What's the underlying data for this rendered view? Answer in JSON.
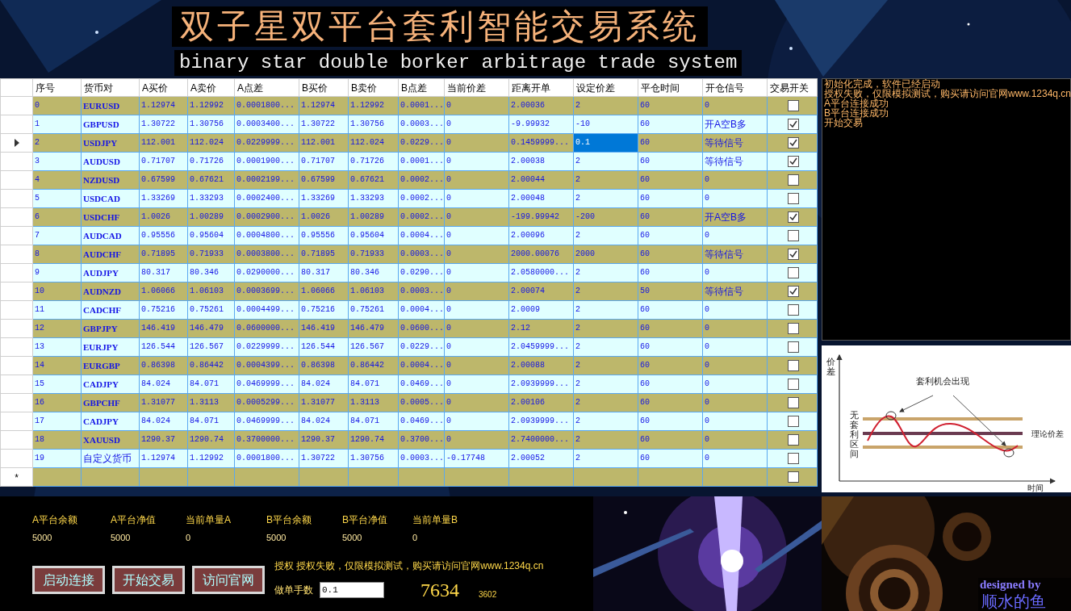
{
  "title": "双子星双平台套利智能交易系统",
  "subtitle": "binary star double borker arbitrage trade system",
  "table": {
    "columns": [
      {
        "label": "序号",
        "kind": "text"
      },
      {
        "label": "货币对",
        "kind": "pair"
      },
      {
        "label": "A买价",
        "kind": "text"
      },
      {
        "label": "A卖价",
        "kind": "text"
      },
      {
        "label": "A点差",
        "kind": "text"
      },
      {
        "label": "B买价",
        "kind": "text"
      },
      {
        "label": "B卖价",
        "kind": "text"
      },
      {
        "label": "B点差",
        "kind": "text"
      },
      {
        "label": "当前价差",
        "kind": "text"
      },
      {
        "label": "距离开单",
        "kind": "text"
      },
      {
        "label": "设定价差",
        "kind": "editable"
      },
      {
        "label": "平仓时间",
        "kind": "text"
      },
      {
        "label": "开仓信号",
        "kind": "text"
      },
      {
        "label": "交易开关",
        "kind": "check"
      }
    ],
    "rows": [
      {
        "cells": [
          "0",
          "EURUSD",
          "1.12974",
          "1.12992",
          "0.0001800...",
          "1.12974",
          "1.12992",
          "0.0001...",
          "0",
          "2.00036",
          "2",
          "60",
          "0"
        ],
        "trade_on": false,
        "selected": false
      },
      {
        "cells": [
          "1",
          "GBPUSD",
          "1.30722",
          "1.30756",
          "0.0003400...",
          "1.30722",
          "1.30756",
          "0.0003...",
          "0",
          "-9.99932",
          "-10",
          "60",
          "开A空B多"
        ],
        "trade_on": true,
        "selected": false
      },
      {
        "cells": [
          "2",
          "USDJPY",
          "112.001",
          "112.024",
          "0.0229999...",
          "112.001",
          "112.024",
          "0.0229...",
          "0",
          "0.1459999...",
          "0.1",
          "60",
          "等待信号"
        ],
        "trade_on": true,
        "selected": true
      },
      {
        "cells": [
          "3",
          "AUDUSD",
          "0.71707",
          "0.71726",
          "0.0001900...",
          "0.71707",
          "0.71726",
          "0.0001...",
          "0",
          "2.00038",
          "2",
          "60",
          "等待信号"
        ],
        "trade_on": true,
        "selected": false
      },
      {
        "cells": [
          "4",
          "NZDUSD",
          "0.67599",
          "0.67621",
          "0.0002199...",
          "0.67599",
          "0.67621",
          "0.0002...",
          "0",
          "2.00044",
          "2",
          "60",
          "0"
        ],
        "trade_on": false,
        "selected": false
      },
      {
        "cells": [
          "5",
          "USDCAD",
          "1.33269",
          "1.33293",
          "0.0002400...",
          "1.33269",
          "1.33293",
          "0.0002...",
          "0",
          "2.00048",
          "2",
          "60",
          "0"
        ],
        "trade_on": false,
        "selected": false
      },
      {
        "cells": [
          "6",
          "USDCHF",
          "1.0026",
          "1.00289",
          "0.0002900...",
          "1.0026",
          "1.00289",
          "0.0002...",
          "0",
          "-199.99942",
          "-200",
          "60",
          "开A空B多"
        ],
        "trade_on": true,
        "selected": false
      },
      {
        "cells": [
          "7",
          "AUDCAD",
          "0.95556",
          "0.95604",
          "0.0004800...",
          "0.95556",
          "0.95604",
          "0.0004...",
          "0",
          "2.00096",
          "2",
          "60",
          "0"
        ],
        "trade_on": false,
        "selected": false
      },
      {
        "cells": [
          "8",
          "AUDCHF",
          "0.71895",
          "0.71933",
          "0.0003800...",
          "0.71895",
          "0.71933",
          "0.0003...",
          "0",
          "2000.00076",
          "2000",
          "60",
          "等待信号"
        ],
        "trade_on": true,
        "selected": false
      },
      {
        "cells": [
          "9",
          "AUDJPY",
          "80.317",
          "80.346",
          "0.0290000...",
          "80.317",
          "80.346",
          "0.0290...",
          "0",
          "2.0580000...",
          "2",
          "60",
          "0"
        ],
        "trade_on": false,
        "selected": false
      },
      {
        "cells": [
          "10",
          "AUDNZD",
          "1.06066",
          "1.06103",
          "0.0003699...",
          "1.06066",
          "1.06103",
          "0.0003...",
          "0",
          "2.00074",
          "2",
          "50",
          "等待信号"
        ],
        "trade_on": true,
        "selected": false
      },
      {
        "cells": [
          "11",
          "CADCHF",
          "0.75216",
          "0.75261",
          "0.0004499...",
          "0.75216",
          "0.75261",
          "0.0004...",
          "0",
          "2.0009",
          "2",
          "60",
          "0"
        ],
        "trade_on": false,
        "selected": false
      },
      {
        "cells": [
          "12",
          "GBPJPY",
          "146.419",
          "146.479",
          "0.0600000...",
          "146.419",
          "146.479",
          "0.0600...",
          "0",
          "2.12",
          "2",
          "60",
          "0"
        ],
        "trade_on": false,
        "selected": false
      },
      {
        "cells": [
          "13",
          "EURJPY",
          "126.544",
          "126.567",
          "0.0229999...",
          "126.544",
          "126.567",
          "0.0229...",
          "0",
          "2.0459999...",
          "2",
          "60",
          "0"
        ],
        "trade_on": false,
        "selected": false
      },
      {
        "cells": [
          "14",
          "EURGBP",
          "0.86398",
          "0.86442",
          "0.0004399...",
          "0.86398",
          "0.86442",
          "0.0004...",
          "0",
          "2.00088",
          "2",
          "60",
          "0"
        ],
        "trade_on": false,
        "selected": false
      },
      {
        "cells": [
          "15",
          "CADJPY",
          "84.024",
          "84.071",
          "0.0469999...",
          "84.024",
          "84.071",
          "0.0469...",
          "0",
          "2.0939999...",
          "2",
          "60",
          "0"
        ],
        "trade_on": false,
        "selected": false
      },
      {
        "cells": [
          "16",
          "GBPCHF",
          "1.31077",
          "1.3113",
          "0.0005299...",
          "1.31077",
          "1.3113",
          "0.0005...",
          "0",
          "2.00106",
          "2",
          "60",
          "0"
        ],
        "trade_on": false,
        "selected": false
      },
      {
        "cells": [
          "17",
          "CADJPY",
          "84.024",
          "84.071",
          "0.0469999...",
          "84.024",
          "84.071",
          "0.0469...",
          "0",
          "2.0939999...",
          "2",
          "60",
          "0"
        ],
        "trade_on": false,
        "selected": false
      },
      {
        "cells": [
          "18",
          "XAUUSD",
          "1290.37",
          "1290.74",
          "0.3700000...",
          "1290.37",
          "1290.74",
          "0.3700...",
          "0",
          "2.7400000...",
          "2",
          "60",
          "0"
        ],
        "trade_on": false,
        "selected": false
      },
      {
        "cells": [
          "19",
          "自定义货币",
          "1.12974",
          "1.12992",
          "0.0001800...",
          "1.30722",
          "1.30756",
          "0.0003...",
          "-0.17748",
          "2.00052",
          "2",
          "60",
          "0"
        ],
        "trade_on": false,
        "selected": false
      }
    ],
    "new_row": {
      "marker": "*",
      "trade_on": false
    }
  },
  "log": [
    "初始化完成，软件已经启动",
    "授权失败，仅限模拟测试，购买请访问官网www.1234q.cn",
    "A平台连接成功",
    "B平台连接成功",
    "开始交易"
  ],
  "diagram": {
    "y_axis_label": "价差",
    "callout": "套利机会出现",
    "band_label": "无套利区间",
    "line_label": "理论价差",
    "x_axis_label": "时间"
  },
  "stats": [
    {
      "label": "A平台余额",
      "value": "5000"
    },
    {
      "label": "A平台净值",
      "value": "5000"
    },
    {
      "label": "当前单量A",
      "value": "0"
    },
    {
      "label": "B平台余额",
      "value": "5000"
    },
    {
      "label": "B平台净值",
      "value": "5000"
    },
    {
      "label": "当前单量B",
      "value": "0"
    }
  ],
  "buttons": [
    "启动连接",
    "开始交易",
    "访问官网"
  ],
  "auth_message": "授权 授权失败，仅限模拟测试，购买请访问官网www.1234q.cn",
  "lot_field": {
    "label": "做单手数",
    "value": "0.1"
  },
  "counter_large": "7634",
  "counter_small": "3602",
  "credits": {
    "line_1": "designed by",
    "line_2": "顺水的鱼"
  }
}
